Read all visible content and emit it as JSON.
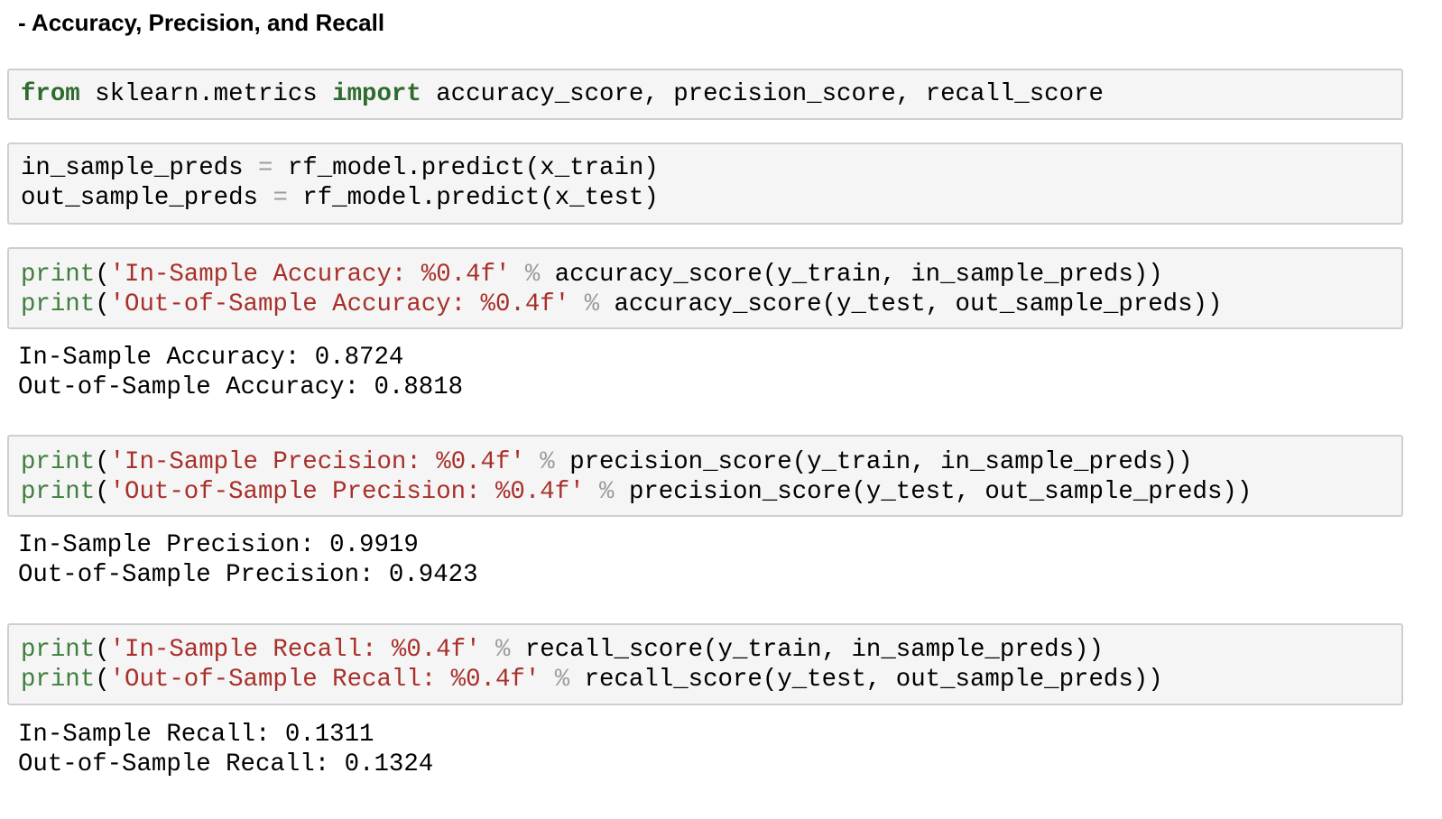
{
  "section": {
    "heading": "- Accuracy, Precision, and Recall"
  },
  "cells": {
    "import": {
      "kw_from": "from",
      "module": " sklearn.metrics ",
      "kw_import": "import",
      "names": " accuracy_score, precision_score, recall_score"
    },
    "preds": {
      "line1_var": "in_sample_preds ",
      "line1_op": "=",
      "line1_rhs": " rf_model.predict(x_train)",
      "line2_var": "out_sample_preds ",
      "line2_op": "=",
      "line2_rhs": " rf_model.predict(x_test)"
    },
    "accuracy": {
      "line1_fn": "print",
      "line1_open": "(",
      "line1_str": "'In-Sample Accuracy: %0.4f'",
      "line1_op": " % ",
      "line1_rest": "accuracy_score(y_train, in_sample_preds))",
      "line2_fn": "print",
      "line2_open": "(",
      "line2_str": "'Out-of-Sample Accuracy: %0.4f'",
      "line2_op": " % ",
      "line2_rest": "accuracy_score(y_test, out_sample_preds))",
      "output1": "In-Sample Accuracy: 0.8724",
      "output2": "Out-of-Sample Accuracy: 0.8818"
    },
    "precision": {
      "line1_fn": "print",
      "line1_open": "(",
      "line1_str": "'In-Sample Precision: %0.4f'",
      "line1_op": " % ",
      "line1_rest": "precision_score(y_train, in_sample_preds))",
      "line2_fn": "print",
      "line2_open": "(",
      "line2_str": "'Out-of-Sample Precision: %0.4f'",
      "line2_op": " % ",
      "line2_rest": "precision_score(y_test, out_sample_preds))",
      "output1": "In-Sample Precision: 0.9919",
      "output2": "Out-of-Sample Precision: 0.9423"
    },
    "recall": {
      "line1_fn": "print",
      "line1_open": "(",
      "line1_str": "'In-Sample Recall: %0.4f'",
      "line1_op": " % ",
      "line1_rest": "recall_score(y_train, in_sample_preds))",
      "line2_fn": "print",
      "line2_open": "(",
      "line2_str": "'Out-of-Sample Recall: %0.4f'",
      "line2_op": " % ",
      "line2_rest": "recall_score(y_test, out_sample_preds))",
      "output1": "In-Sample Recall: 0.1311",
      "output2": "Out-of-Sample Recall: 0.1324"
    }
  },
  "colors": {
    "keyword": "#2f6a2f",
    "builtin": "#3f7f3f",
    "string": "#a8302a",
    "operator": "#9c9c9c",
    "cell_background": "#f5f5f5",
    "cell_border": "#cfcfcf"
  }
}
